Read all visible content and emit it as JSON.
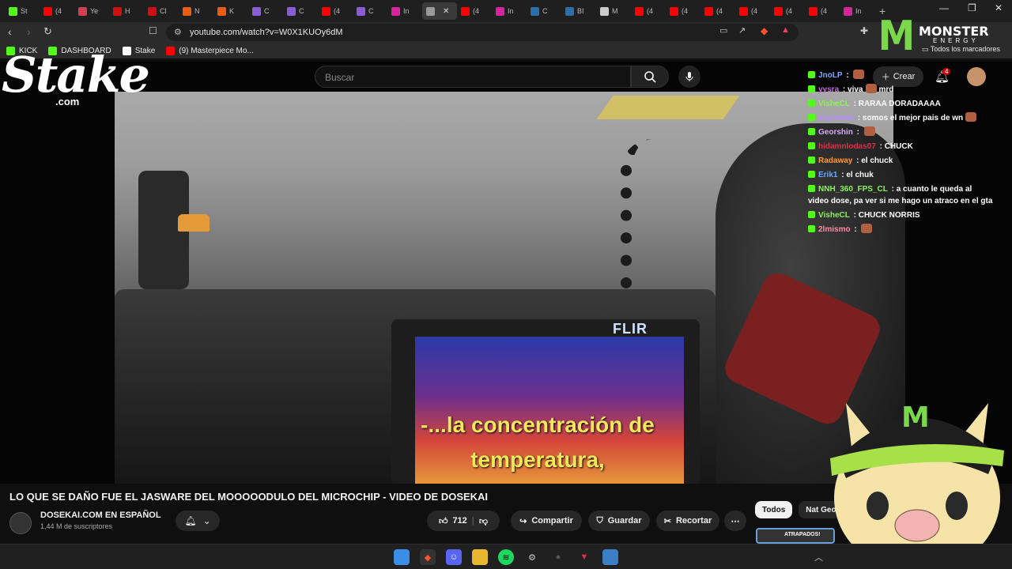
{
  "browser": {
    "tabs": [
      {
        "label": "St",
        "color": "#53fc18"
      },
      {
        "label": "(4",
        "color": "#ff0000"
      },
      {
        "label": "Ye",
        "color": "#d04050"
      },
      {
        "label": "H",
        "color": "#d01010"
      },
      {
        "label": "Cl",
        "color": "#d01010"
      },
      {
        "label": "N",
        "color": "#e85d10"
      },
      {
        "label": "K",
        "color": "#e85d10"
      },
      {
        "label": "C",
        "color": "#8a5cd8"
      },
      {
        "label": "C",
        "color": "#8a5cd8"
      },
      {
        "label": "(4",
        "color": "#ff0000"
      },
      {
        "label": "C",
        "color": "#8a5cd8"
      },
      {
        "label": "In",
        "color": "#d6249f"
      },
      {
        "label": "",
        "color": "#999999",
        "active": true
      },
      {
        "label": "(4",
        "color": "#ff0000"
      },
      {
        "label": "In",
        "color": "#d6249f"
      },
      {
        "label": "C",
        "color": "#2a6fa8"
      },
      {
        "label": "BI",
        "color": "#2a6fa8"
      },
      {
        "label": "M",
        "color": "#cccccc"
      },
      {
        "label": "(4",
        "color": "#ff0000"
      },
      {
        "label": "(4",
        "color": "#ff0000"
      },
      {
        "label": "(4",
        "color": "#ff0000"
      },
      {
        "label": "(4",
        "color": "#ff0000"
      },
      {
        "label": "(4",
        "color": "#ff0000"
      },
      {
        "label": "(4",
        "color": "#ff0000"
      },
      {
        "label": "In",
        "color": "#d6249f"
      }
    ],
    "new_tab": "+",
    "url": "youtube.com/watch?v=W0X1KUOy6dM",
    "bookmarks": [
      {
        "label": "KICK",
        "color": "#53fc18"
      },
      {
        "label": "DASHBOARD",
        "color": "#53fc18"
      },
      {
        "label": "Stake",
        "color": "#ffffff"
      },
      {
        "label": "(9) Masterpiece Mo...",
        "color": "#ff0000"
      }
    ],
    "all_bookmarks": "Todos los marcadores"
  },
  "youtube": {
    "search_placeholder": "Buscar",
    "create_label": "Crear",
    "notif_count": "4",
    "video": {
      "subtitle_line1": "-...la concentración de",
      "subtitle_line2": "temperatura,",
      "flir_label": "FLIR"
    },
    "title": "LO QUE SE DAÑO FUE EL JASWARE DEL MOOOOODULO DEL MICROCHIP - VIDEO DE DOSEKAI",
    "channel": {
      "name": "DOSEKAI.COM EN ESPAÑOL",
      "subscribers": "1,44 M de suscriptores"
    },
    "actions": {
      "likes": "712",
      "share": "Compartir",
      "save": "Guardar",
      "clip": "Recortar",
      "more": "⋯"
    },
    "filters": [
      "Todos",
      "Nat Geo"
    ],
    "next_thumb_text": "ATRAPADOS!"
  },
  "overlay": {
    "stake_logo": "Stake",
    "stake_com": ".com",
    "monster_text": "MONSTER",
    "monster_energy": "ENERGY"
  },
  "chat": [
    {
      "user": "JnoLP",
      "color": "#7aa7ff",
      "text": "",
      "emote": true
    },
    {
      "user": "yysra",
      "color": "#c76bd8",
      "text": "viva",
      "emote": true,
      "after": "mrd",
      "badge": false
    },
    {
      "user": "VisheCL",
      "color": "#8ef05a",
      "text": "RARAA DORADAAAA"
    },
    {
      "user": "sayotrom",
      "color": "#b68bff",
      "text": "somos el mejor pais de wn",
      "emote": true
    },
    {
      "user": "Georshin",
      "color": "#d8a8ff",
      "text": "",
      "emote": true
    },
    {
      "user": "hidamnlodas07",
      "color": "#d8324a",
      "text": "CHUCK"
    },
    {
      "user": "Radaway",
      "color": "#ff9a3a",
      "text": "el chuck"
    },
    {
      "user": "Erik1",
      "color": "#6aa8ff",
      "text": "el chuk"
    },
    {
      "user": "NNH_360_FPS_CL",
      "color": "#8ef05a",
      "text": "a cuanto le queda al video dose, pa ver si me hago un atraco en el gta"
    },
    {
      "user": "VisheCL",
      "color": "#8ef05a",
      "text": "CHUCK NORRIS"
    },
    {
      "user": "2lmismo",
      "color": "#ff8aa8",
      "text": "",
      "emote": true
    }
  ]
}
